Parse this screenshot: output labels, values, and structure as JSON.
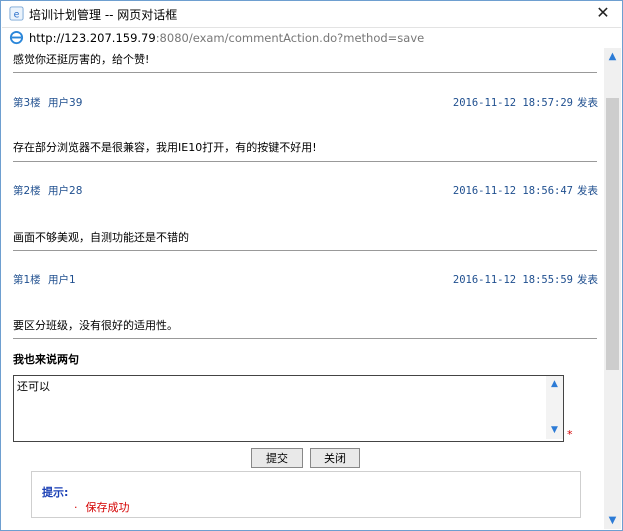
{
  "window": {
    "title": "培训计划管理 -- 网页对话框",
    "close_glyph": "✕",
    "url_host": "http://123.207.159.79",
    "url_rest": ":8080/exam/commentAction.do?method=save"
  },
  "comments_top": {
    "text": "感觉你还挺厉害的，给个赞!"
  },
  "comments": [
    {
      "floor": "第3楼",
      "user": "用户39",
      "datetime": "2016-11-12 18:57:29",
      "post_label": "发表",
      "text": "存在部分浏览器不是很兼容，我用IE10打开，有的按键不好用!"
    },
    {
      "floor": "第2楼",
      "user": "用户28",
      "datetime": "2016-11-12 18:56:47",
      "post_label": "发表",
      "text": "画面不够美观，自测功能还是不错的"
    },
    {
      "floor": "第1楼",
      "user": "用户1",
      "datetime": "2016-11-12 18:55:59",
      "post_label": "发表",
      "text": "要区分班级，没有很好的适用性。"
    }
  ],
  "form": {
    "heading": "我也来说两句",
    "textarea_value": "还可以",
    "required_mark": "*",
    "submit_label": "提交",
    "close_label": "关闭"
  },
  "tip": {
    "label": "提示:",
    "bullet": "·",
    "message": "保存成功"
  },
  "colors": {
    "accent_link": "#1f4f8f",
    "tip_label": "#1a3fb5",
    "error_red": "#d40000"
  }
}
